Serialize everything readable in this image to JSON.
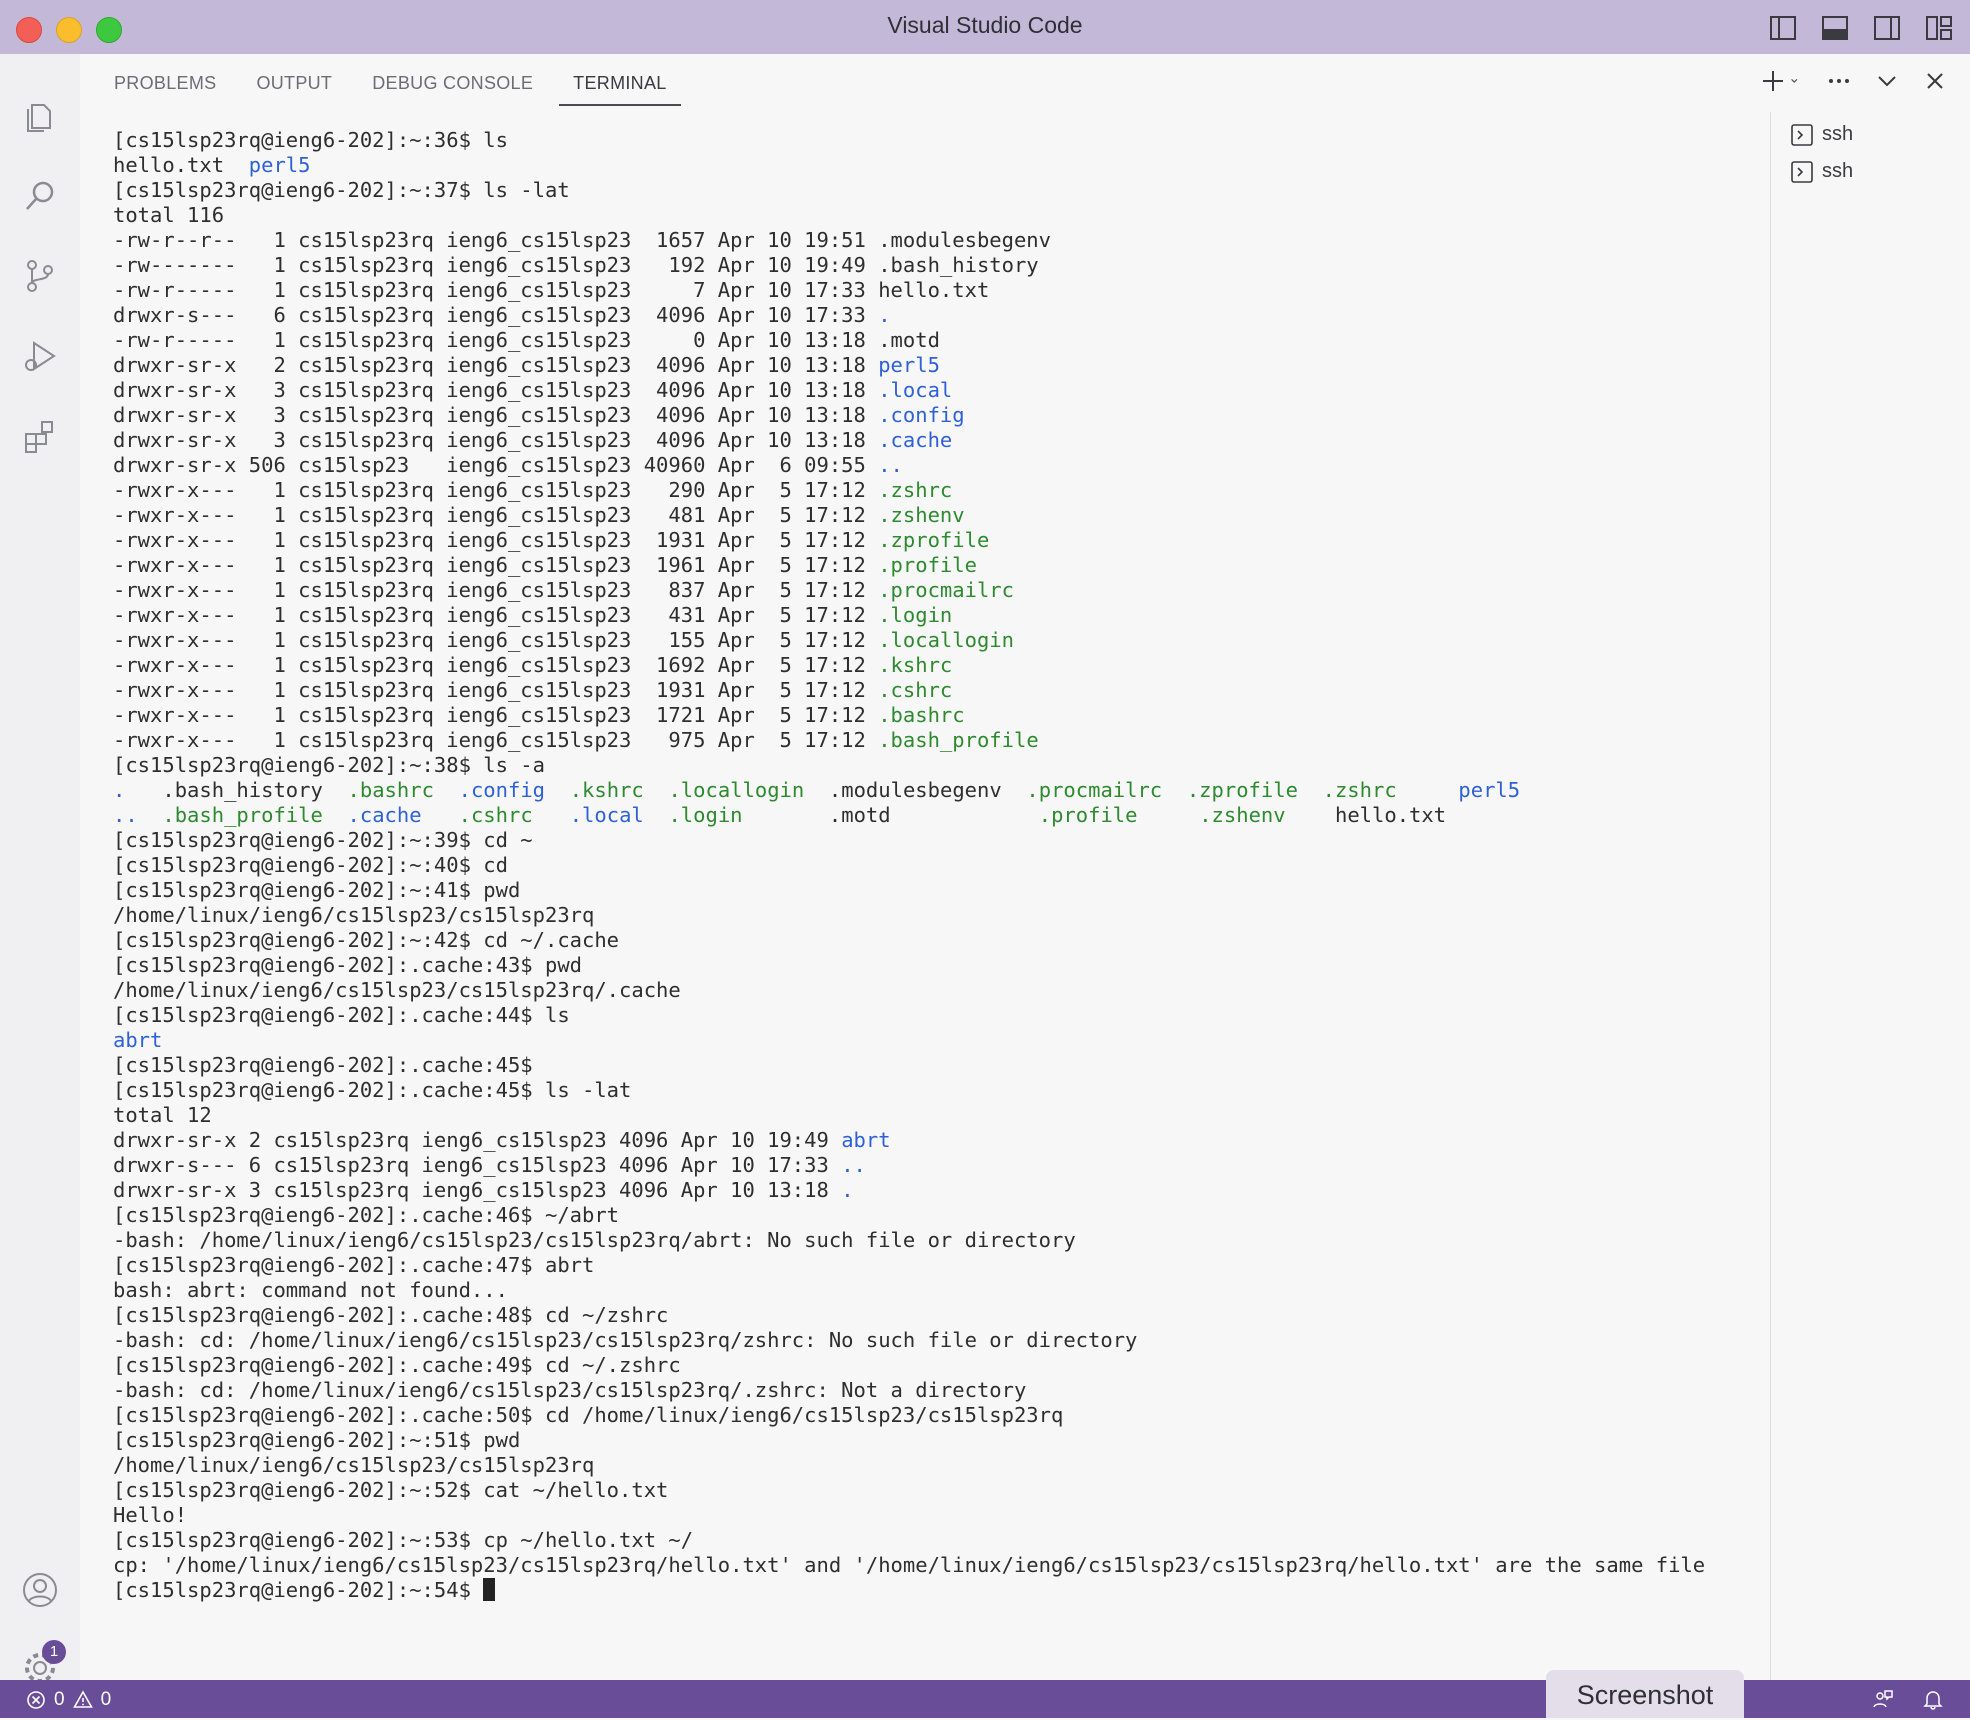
{
  "window": {
    "title": "Visual Studio Code"
  },
  "panel": {
    "tabs": [
      {
        "label": "PROBLEMS",
        "active": false
      },
      {
        "label": "OUTPUT",
        "active": false
      },
      {
        "label": "DEBUG CONSOLE",
        "active": false
      },
      {
        "label": "TERMINAL",
        "active": true
      }
    ]
  },
  "terminal_list": [
    {
      "label": "ssh"
    },
    {
      "label": "ssh"
    }
  ],
  "terminal": {
    "lines": [
      [
        {
          "t": "[cs15lsp23rq@ieng6-202]:~:36$ ls"
        }
      ],
      [
        {
          "t": "hello.txt  "
        },
        {
          "t": "perl5",
          "c": "b"
        }
      ],
      [
        {
          "t": "[cs15lsp23rq@ieng6-202]:~:37$ ls -lat"
        }
      ],
      [
        {
          "t": "total 116"
        }
      ],
      [
        {
          "t": "-rw-r--r--   1 cs15lsp23rq ieng6_cs15lsp23  1657 Apr 10 19:51 .modulesbegenv"
        }
      ],
      [
        {
          "t": "-rw-------   1 cs15lsp23rq ieng6_cs15lsp23   192 Apr 10 19:49 .bash_history"
        }
      ],
      [
        {
          "t": "-rw-r-----   1 cs15lsp23rq ieng6_cs15lsp23     7 Apr 10 17:33 hello.txt"
        }
      ],
      [
        {
          "t": "drwxr-s---   6 cs15lsp23rq ieng6_cs15lsp23  4096 Apr 10 17:33 "
        },
        {
          "t": ".",
          "c": "b"
        }
      ],
      [
        {
          "t": "-rw-r-----   1 cs15lsp23rq ieng6_cs15lsp23     0 Apr 10 13:18 .motd"
        }
      ],
      [
        {
          "t": "drwxr-sr-x   2 cs15lsp23rq ieng6_cs15lsp23  4096 Apr 10 13:18 "
        },
        {
          "t": "perl5",
          "c": "b"
        }
      ],
      [
        {
          "t": "drwxr-sr-x   3 cs15lsp23rq ieng6_cs15lsp23  4096 Apr 10 13:18 "
        },
        {
          "t": ".local",
          "c": "b"
        }
      ],
      [
        {
          "t": "drwxr-sr-x   3 cs15lsp23rq ieng6_cs15lsp23  4096 Apr 10 13:18 "
        },
        {
          "t": ".config",
          "c": "b"
        }
      ],
      [
        {
          "t": "drwxr-sr-x   3 cs15lsp23rq ieng6_cs15lsp23  4096 Apr 10 13:18 "
        },
        {
          "t": ".cache",
          "c": "b"
        }
      ],
      [
        {
          "t": "drwxr-sr-x 506 cs15lsp23   ieng6_cs15lsp23 40960 Apr  6 09:55 "
        },
        {
          "t": "..",
          "c": "b"
        }
      ],
      [
        {
          "t": "-rwxr-x---   1 cs15lsp23rq ieng6_cs15lsp23   290 Apr  5 17:12 "
        },
        {
          "t": ".zshrc",
          "c": "g"
        }
      ],
      [
        {
          "t": "-rwxr-x---   1 cs15lsp23rq ieng6_cs15lsp23   481 Apr  5 17:12 "
        },
        {
          "t": ".zshenv",
          "c": "g"
        }
      ],
      [
        {
          "t": "-rwxr-x---   1 cs15lsp23rq ieng6_cs15lsp23  1931 Apr  5 17:12 "
        },
        {
          "t": ".zprofile",
          "c": "g"
        }
      ],
      [
        {
          "t": "-rwxr-x---   1 cs15lsp23rq ieng6_cs15lsp23  1961 Apr  5 17:12 "
        },
        {
          "t": ".profile",
          "c": "g"
        }
      ],
      [
        {
          "t": "-rwxr-x---   1 cs15lsp23rq ieng6_cs15lsp23   837 Apr  5 17:12 "
        },
        {
          "t": ".procmailrc",
          "c": "g"
        }
      ],
      [
        {
          "t": "-rwxr-x---   1 cs15lsp23rq ieng6_cs15lsp23   431 Apr  5 17:12 "
        },
        {
          "t": ".login",
          "c": "g"
        }
      ],
      [
        {
          "t": "-rwxr-x---   1 cs15lsp23rq ieng6_cs15lsp23   155 Apr  5 17:12 "
        },
        {
          "t": ".locallogin",
          "c": "g"
        }
      ],
      [
        {
          "t": "-rwxr-x---   1 cs15lsp23rq ieng6_cs15lsp23  1692 Apr  5 17:12 "
        },
        {
          "t": ".kshrc",
          "c": "g"
        }
      ],
      [
        {
          "t": "-rwxr-x---   1 cs15lsp23rq ieng6_cs15lsp23  1931 Apr  5 17:12 "
        },
        {
          "t": ".cshrc",
          "c": "g"
        }
      ],
      [
        {
          "t": "-rwxr-x---   1 cs15lsp23rq ieng6_cs15lsp23  1721 Apr  5 17:12 "
        },
        {
          "t": ".bashrc",
          "c": "g"
        }
      ],
      [
        {
          "t": "-rwxr-x---   1 cs15lsp23rq ieng6_cs15lsp23   975 Apr  5 17:12 "
        },
        {
          "t": ".bash_profile",
          "c": "g"
        }
      ],
      [
        {
          "t": "[cs15lsp23rq@ieng6-202]:~:38$ ls -a"
        }
      ],
      [
        {
          "t": ".",
          "c": "b"
        },
        {
          "t": "   .bash_history  "
        },
        {
          "t": ".bashrc",
          "c": "g"
        },
        {
          "t": "  "
        },
        {
          "t": ".config",
          "c": "b"
        },
        {
          "t": "  "
        },
        {
          "t": ".kshrc",
          "c": "g"
        },
        {
          "t": "  "
        },
        {
          "t": ".locallogin",
          "c": "g"
        },
        {
          "t": "  .modulesbegenv  "
        },
        {
          "t": ".procmailrc",
          "c": "g"
        },
        {
          "t": "  "
        },
        {
          "t": ".zprofile",
          "c": "g"
        },
        {
          "t": "  "
        },
        {
          "t": ".zshrc",
          "c": "g"
        },
        {
          "t": "     "
        },
        {
          "t": "perl5",
          "c": "b"
        }
      ],
      [
        {
          "t": "..",
          "c": "b"
        },
        {
          "t": "  "
        },
        {
          "t": ".bash_profile",
          "c": "g"
        },
        {
          "t": "  "
        },
        {
          "t": ".cache",
          "c": "b"
        },
        {
          "t": "   "
        },
        {
          "t": ".cshrc",
          "c": "g"
        },
        {
          "t": "   "
        },
        {
          "t": ".local",
          "c": "b"
        },
        {
          "t": "  "
        },
        {
          "t": ".login",
          "c": "g"
        },
        {
          "t": "       .motd            "
        },
        {
          "t": ".profile",
          "c": "g"
        },
        {
          "t": "     "
        },
        {
          "t": ".zshenv",
          "c": "g"
        },
        {
          "t": "    hello.txt"
        }
      ],
      [
        {
          "t": "[cs15lsp23rq@ieng6-202]:~:39$ cd ~"
        }
      ],
      [
        {
          "t": "[cs15lsp23rq@ieng6-202]:~:40$ cd"
        }
      ],
      [
        {
          "t": "[cs15lsp23rq@ieng6-202]:~:41$ pwd"
        }
      ],
      [
        {
          "t": "/home/linux/ieng6/cs15lsp23/cs15lsp23rq"
        }
      ],
      [
        {
          "t": "[cs15lsp23rq@ieng6-202]:~:42$ cd ~/.cache"
        }
      ],
      [
        {
          "t": "[cs15lsp23rq@ieng6-202]:.cache:43$ pwd"
        }
      ],
      [
        {
          "t": "/home/linux/ieng6/cs15lsp23/cs15lsp23rq/.cache"
        }
      ],
      [
        {
          "t": "[cs15lsp23rq@ieng6-202]:.cache:44$ ls"
        }
      ],
      [
        {
          "t": "abrt",
          "c": "b"
        }
      ],
      [
        {
          "t": "[cs15lsp23rq@ieng6-202]:.cache:45$"
        }
      ],
      [
        {
          "t": "[cs15lsp23rq@ieng6-202]:.cache:45$ ls -lat"
        }
      ],
      [
        {
          "t": "total 12"
        }
      ],
      [
        {
          "t": "drwxr-sr-x 2 cs15lsp23rq ieng6_cs15lsp23 4096 Apr 10 19:49 "
        },
        {
          "t": "abrt",
          "c": "b"
        }
      ],
      [
        {
          "t": "drwxr-s--- 6 cs15lsp23rq ieng6_cs15lsp23 4096 Apr 10 17:33 "
        },
        {
          "t": "..",
          "c": "b"
        }
      ],
      [
        {
          "t": "drwxr-sr-x 3 cs15lsp23rq ieng6_cs15lsp23 4096 Apr 10 13:18 "
        },
        {
          "t": ".",
          "c": "b"
        }
      ],
      [
        {
          "t": "[cs15lsp23rq@ieng6-202]:.cache:46$ ~/abrt"
        }
      ],
      [
        {
          "t": "-bash: /home/linux/ieng6/cs15lsp23/cs15lsp23rq/abrt: No such file or directory"
        }
      ],
      [
        {
          "t": "[cs15lsp23rq@ieng6-202]:.cache:47$ abrt"
        }
      ],
      [
        {
          "t": "bash: abrt: command not found..."
        }
      ],
      [
        {
          "t": "[cs15lsp23rq@ieng6-202]:.cache:48$ cd ~/zshrc"
        }
      ],
      [
        {
          "t": "-bash: cd: /home/linux/ieng6/cs15lsp23/cs15lsp23rq/zshrc: No such file or directory"
        }
      ],
      [
        {
          "t": "[cs15lsp23rq@ieng6-202]:.cache:49$ cd ~/.zshrc"
        }
      ],
      [
        {
          "t": "-bash: cd: /home/linux/ieng6/cs15lsp23/cs15lsp23rq/.zshrc: Not a directory"
        }
      ],
      [
        {
          "t": "[cs15lsp23rq@ieng6-202]:.cache:50$ cd /home/linux/ieng6/cs15lsp23/cs15lsp23rq"
        }
      ],
      [
        {
          "t": "[cs15lsp23rq@ieng6-202]:~:51$ pwd"
        }
      ],
      [
        {
          "t": "/home/linux/ieng6/cs15lsp23/cs15lsp23rq"
        }
      ],
      [
        {
          "t": "[cs15lsp23rq@ieng6-202]:~:52$ cat ~/hello.txt"
        }
      ],
      [
        {
          "t": "Hello!"
        }
      ],
      [
        {
          "t": "[cs15lsp23rq@ieng6-202]:~:53$ cp ~/hello.txt ~/"
        }
      ],
      [
        {
          "t": "cp: '/home/linux/ieng6/cs15lsp23/cs15lsp23rq/hello.txt' and '/home/linux/ieng6/cs15lsp23/cs15lsp23rq/hello.txt' are the same file"
        }
      ],
      [
        {
          "t": "[cs15lsp23rq@ieng6-202]:~:54$ "
        }
      ]
    ]
  },
  "activity_bar": {
    "icons": [
      "explorer-icon",
      "search-icon",
      "source-control-icon",
      "run-debug-icon",
      "extensions-icon"
    ],
    "accounts_icon": "account-icon",
    "manage_icon": "gear-icon",
    "manage_badge": "1"
  },
  "statusbar": {
    "errors": "0",
    "warnings": "0"
  },
  "overlay": {
    "screenshot_label": "Screenshot"
  },
  "colors": {
    "accent": "#6a4d98",
    "titlebar": "#c4b8d9",
    "dir": "#2e61d6",
    "exec": "#2e8a2e"
  }
}
